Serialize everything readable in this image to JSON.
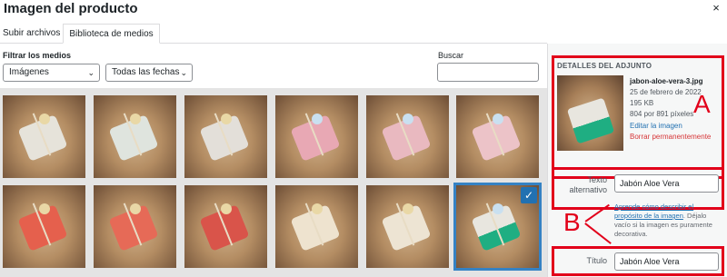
{
  "modal": {
    "title": "Imagen del producto",
    "close": "×"
  },
  "tabs": [
    {
      "label": "Subir archivos"
    },
    {
      "label": "Biblioteca de medios"
    }
  ],
  "filter": {
    "label": "Filtrar los medios",
    "type_select": "Imágenes",
    "date_select": "Todas las fechas"
  },
  "search": {
    "label": "Buscar",
    "value": ""
  },
  "attachment": {
    "section_label": "DETALLES DEL ADJUNTO",
    "filename": "jabon-aloe-vera-3.jpg",
    "date": "25 de febrero de 2022",
    "filesize": "195 KB",
    "dimensions": "804 por 891 píxeles",
    "edit_link": "Editar la imagen",
    "delete_link": "Borrar permanentemente"
  },
  "alt_field": {
    "label": "Texto alternativo",
    "value": "Jabón Aloe Vera",
    "help_link": "Aprende cómo describir el propósito de la imagen",
    "help_text": ". Déjalo vacío si la imagen es puramente decorativa."
  },
  "title_field": {
    "label": "Título",
    "value": "Jabón Aloe Vera"
  },
  "annotations": {
    "a": "A",
    "b": "B"
  },
  "colors": {
    "annotation_red": "#e2001a",
    "wp_blue": "#2271b1",
    "soap_green": "#1fae82"
  }
}
